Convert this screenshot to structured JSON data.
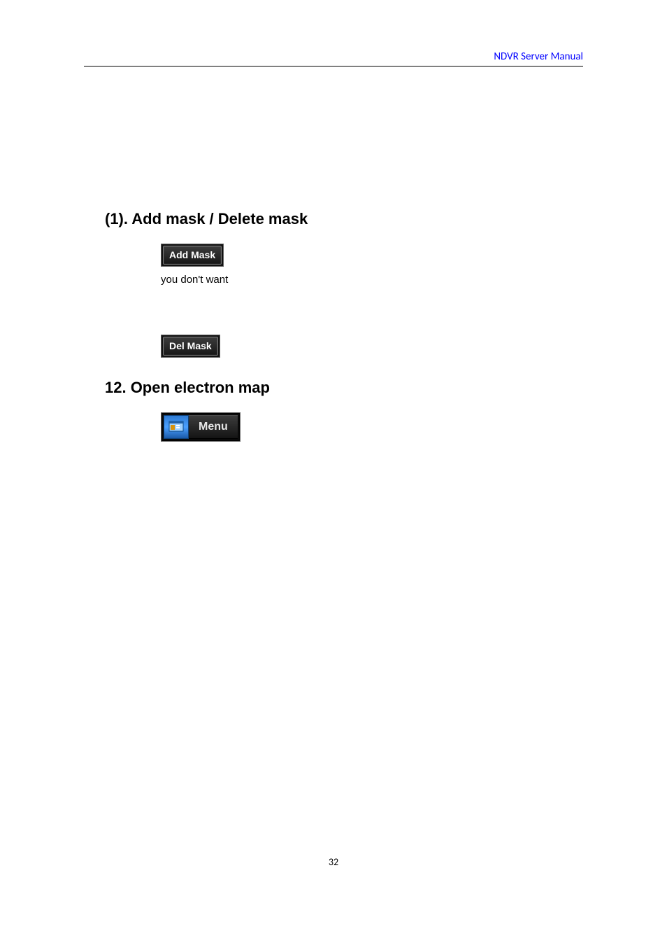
{
  "header": {
    "right_text": "NDVR Server Manual"
  },
  "sections": {
    "s1": {
      "title": "(1). Add mask / Delete mask",
      "add_mask_label": "Add Mask",
      "body_line": "you don't want",
      "del_mask_label": "Del Mask"
    },
    "s2": {
      "title": "12. Open electron map",
      "menu_label": "Menu"
    }
  },
  "page_number": "32"
}
